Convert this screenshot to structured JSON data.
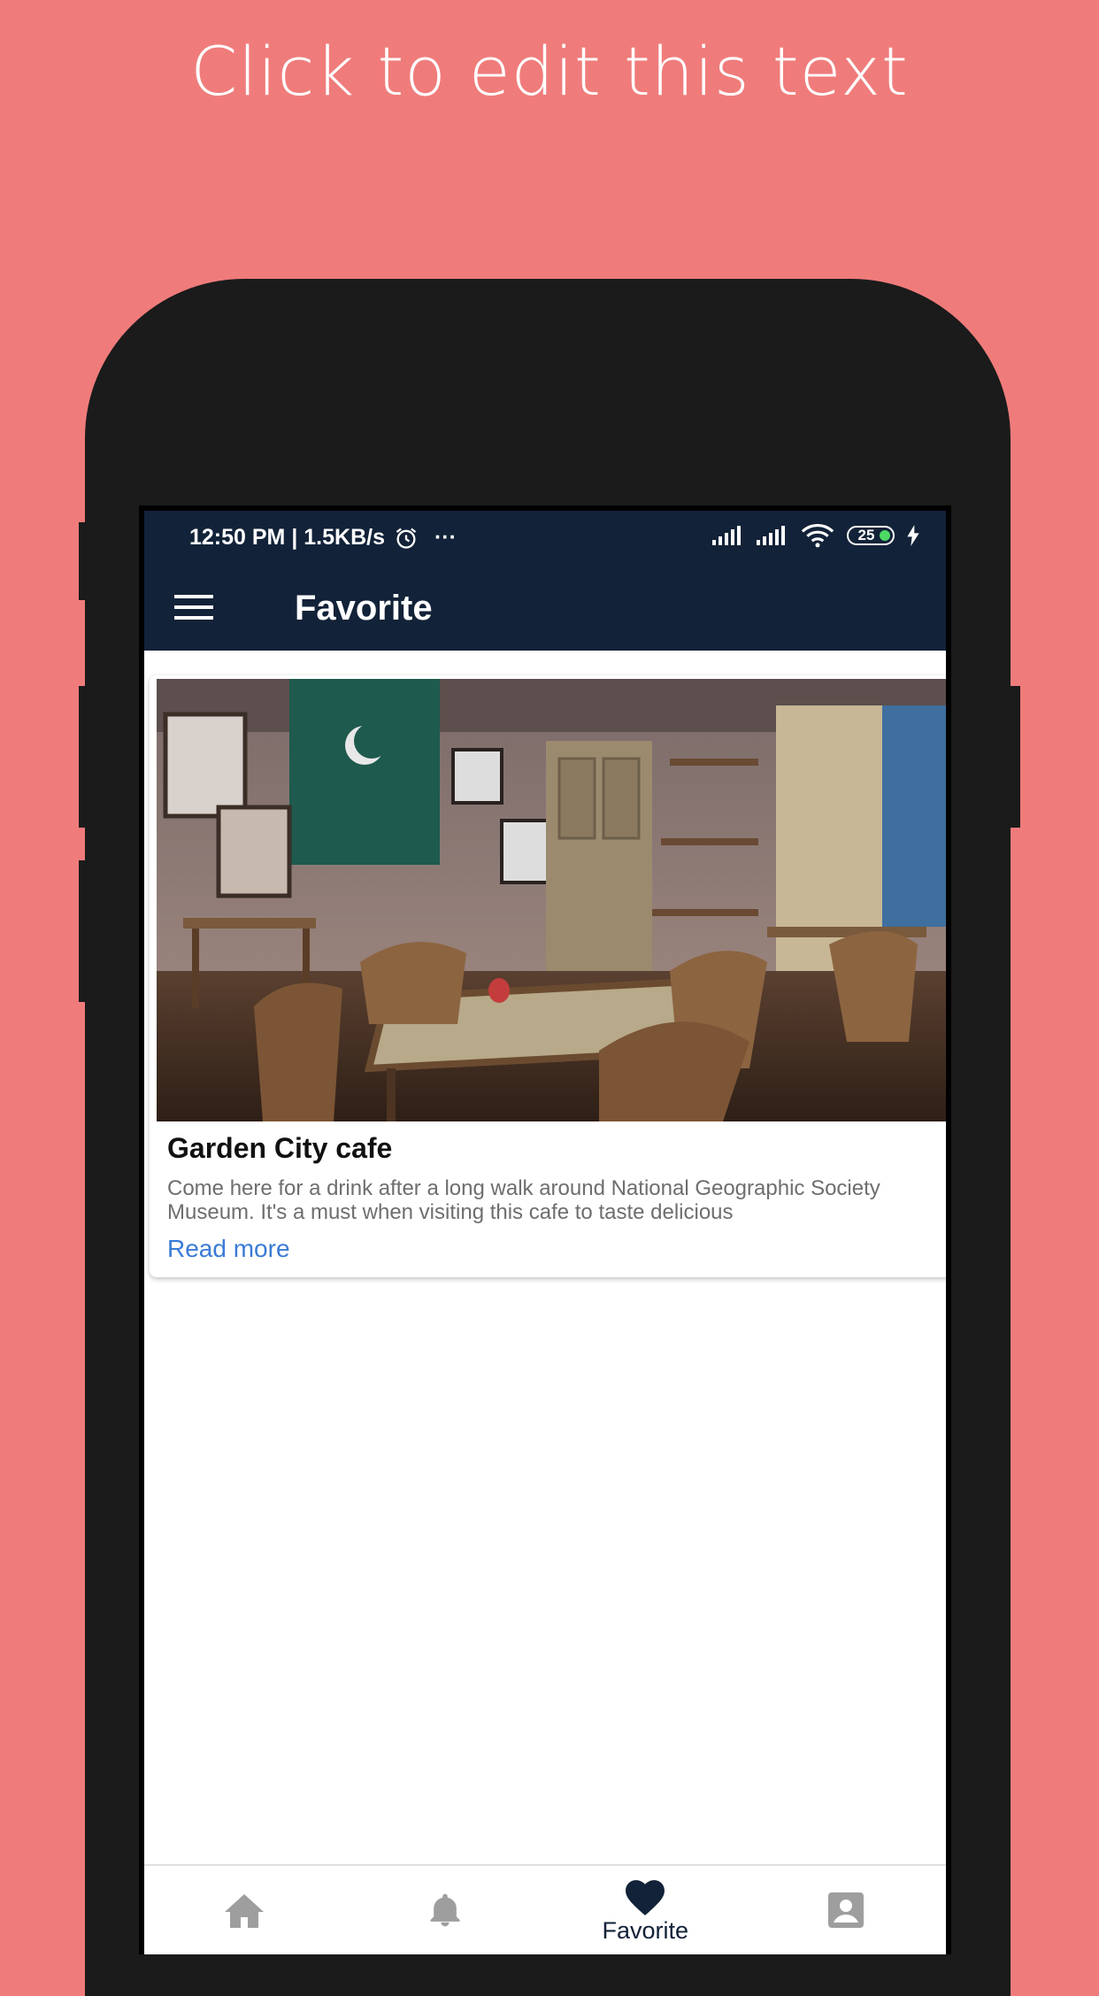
{
  "promo": {
    "text": "Click to edit this text"
  },
  "status_bar": {
    "time_speed": "12:50 PM | 1.5KB/s",
    "more": "···",
    "battery": "25"
  },
  "app_bar": {
    "title": "Favorite"
  },
  "card": {
    "title": "Garden City cafe",
    "description": "Come here for a drink after a long walk around National Geographic Society Museum. It's a must when visiting this cafe to taste delicious",
    "link": "Read more"
  },
  "bottom_nav": {
    "items": [
      {
        "icon": "home-icon",
        "label": ""
      },
      {
        "icon": "bell-icon",
        "label": ""
      },
      {
        "icon": "heart-icon",
        "label": "Favorite",
        "active": true
      },
      {
        "icon": "account-box-icon",
        "label": ""
      }
    ],
    "active_color": "#122238",
    "inactive_color": "#9E9E9E"
  },
  "colors": {
    "background": "#EF7C7B",
    "header": "#122238",
    "link": "#3A7BD5"
  }
}
